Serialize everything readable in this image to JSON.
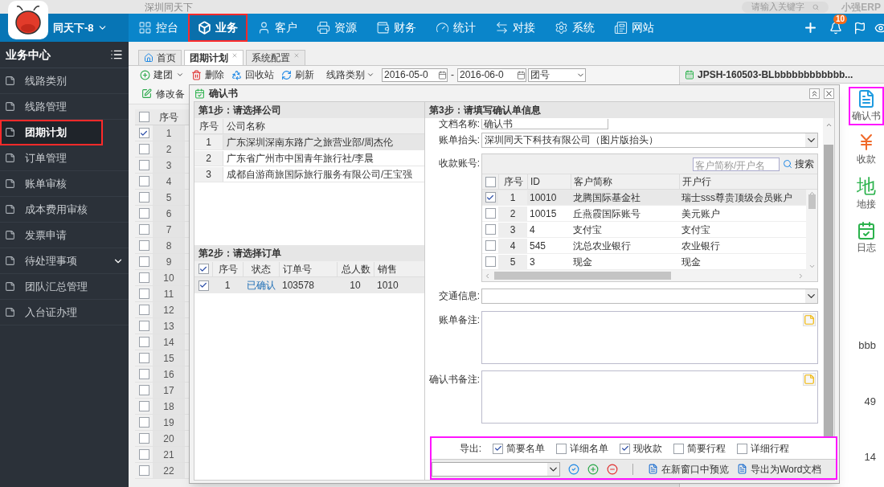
{
  "top_bar": {
    "company": "深圳同天下",
    "search": {
      "placeholder": "请输入关键字"
    },
    "brand": "小强ERP"
  },
  "nav": {
    "account": "同天下-8",
    "notifications": "10",
    "items": [
      {
        "label": "控台",
        "selected": false,
        "highlighted": false
      },
      {
        "label": "业务",
        "selected": true,
        "highlighted": true
      },
      {
        "label": "客户",
        "selected": false,
        "highlighted": false
      },
      {
        "label": "资源",
        "selected": false,
        "highlighted": false
      },
      {
        "label": "财务",
        "selected": false,
        "highlighted": false
      },
      {
        "label": "统计",
        "selected": false,
        "highlighted": false
      },
      {
        "label": "对接",
        "selected": false,
        "highlighted": false
      },
      {
        "label": "系统",
        "selected": false,
        "highlighted": false
      },
      {
        "label": "网站",
        "selected": false,
        "highlighted": false
      }
    ]
  },
  "sidebar": {
    "title": "业务中心",
    "items": [
      {
        "label": "线路类别",
        "selected": false,
        "highlighted": false,
        "expandable": false
      },
      {
        "label": "线路管理",
        "selected": false,
        "highlighted": false,
        "expandable": false
      },
      {
        "label": "团期计划",
        "selected": true,
        "highlighted": true,
        "expandable": false
      },
      {
        "label": "订单管理",
        "selected": false,
        "highlighted": false,
        "expandable": false
      },
      {
        "label": "账单审核",
        "selected": false,
        "highlighted": false,
        "expandable": false
      },
      {
        "label": "成本费用审核",
        "selected": false,
        "highlighted": false,
        "expandable": false
      },
      {
        "label": "发票申请",
        "selected": false,
        "highlighted": false,
        "expandable": false
      },
      {
        "label": "待处理事项",
        "selected": false,
        "highlighted": false,
        "expandable": true
      },
      {
        "label": "团队汇总管理",
        "selected": false,
        "highlighted": false,
        "expandable": false
      },
      {
        "label": "入台证办理",
        "selected": false,
        "highlighted": false,
        "expandable": false
      }
    ]
  },
  "tabs": [
    {
      "label": "首页",
      "selected": false,
      "closable": false
    },
    {
      "label": "团期计划",
      "selected": true,
      "closable": true
    },
    {
      "label": "系统配置",
      "selected": false,
      "closable": true
    }
  ],
  "toolbar": {
    "buttons": [
      {
        "label": "建团",
        "dropdown": true
      },
      {
        "label": "删除",
        "dropdown": false
      },
      {
        "label": "回收站",
        "dropdown": false
      },
      {
        "label": "刷新",
        "dropdown": false
      }
    ],
    "filter": "线路类别",
    "date_from": "2016-05-0",
    "separator": "-",
    "date_to": "2016-06-0",
    "field": "团号",
    "edit_note": "修改备"
  },
  "grid": {
    "column": "序号",
    "all_checked": false,
    "rows": [
      {
        "index": "1",
        "checked": true
      },
      {
        "index": "2",
        "checked": false
      },
      {
        "index": "3",
        "checked": false
      },
      {
        "index": "4",
        "checked": false
      },
      {
        "index": "5",
        "checked": false
      },
      {
        "index": "6",
        "checked": false
      },
      {
        "index": "7",
        "checked": false
      },
      {
        "index": "8",
        "checked": false
      },
      {
        "index": "9",
        "checked": false
      },
      {
        "index": "10",
        "checked": false
      },
      {
        "index": "11",
        "checked": false
      },
      {
        "index": "12",
        "checked": false
      },
      {
        "index": "13",
        "checked": false
      },
      {
        "index": "14",
        "checked": false
      },
      {
        "index": "15",
        "checked": false
      },
      {
        "index": "16",
        "checked": false
      },
      {
        "index": "17",
        "checked": false
      },
      {
        "index": "18",
        "checked": false
      },
      {
        "index": "19",
        "checked": false
      },
      {
        "index": "20",
        "checked": false
      },
      {
        "index": "21",
        "checked": false
      },
      {
        "index": "22",
        "checked": false
      }
    ]
  },
  "detail": {
    "tab": "JPSH-160503-BLbbbbbbbbbbbb...",
    "fragments": [
      "bbb",
      "49",
      "14"
    ],
    "tools": [
      {
        "label": "确认书",
        "kind": "icon",
        "highlighted": true
      },
      {
        "label": "收款",
        "kind": "icon",
        "highlighted": false
      },
      {
        "label": "地接",
        "kind": "glyph",
        "glyph": "地",
        "highlighted": false
      },
      {
        "label": "日志",
        "kind": "icon",
        "highlighted": false
      }
    ]
  },
  "dialog": {
    "title": "确认书",
    "step1": {
      "title": "第1步：请选择公司",
      "columns": [
        "序号",
        "公司名称"
      ],
      "rows": [
        {
          "index": "1",
          "name": "广东深圳深南东路广之旅营业部/周杰伦",
          "selected": true
        },
        {
          "index": "2",
          "name": "广东省广州市中国青年旅行社/李晨",
          "selected": false
        },
        {
          "index": "3",
          "name": "成都自游商旅国际旅行服务有限公司/王宝强",
          "selected": false
        }
      ]
    },
    "step2": {
      "title": "第2步：请选择订单",
      "all_checked": true,
      "columns": [
        "序号",
        "状态",
        "订单号",
        "总人数",
        "销售"
      ],
      "rows": [
        {
          "checked": true,
          "index": "1",
          "status": "已确认",
          "order": "103578",
          "people": "10",
          "sales": "1010"
        }
      ]
    },
    "step3": {
      "title": "第3步：请填写确认单信息",
      "doc_name": {
        "label": "文档名称:",
        "value": "确认书"
      },
      "header": {
        "label": "账单抬头:",
        "value": "深圳同天下科技有限公司（图片版抬头）"
      },
      "accounts": {
        "label": "收款账号:",
        "all_checked": false,
        "search": {
          "placeholder": "客户简称/开户名"
        },
        "search_button": "搜索",
        "columns": [
          "序号",
          "ID",
          "客户简称",
          "开户行"
        ],
        "rows": [
          {
            "checked": true,
            "selected": true,
            "index": "1",
            "id": "10010",
            "name": "龙腾国际基金社",
            "bank": "瑞士sss尊贵顶级会员账户"
          },
          {
            "checked": false,
            "selected": false,
            "index": "2",
            "id": "10015",
            "name": "丘燕霞国际账号",
            "bank": "美元账户"
          },
          {
            "checked": false,
            "selected": false,
            "index": "3",
            "id": "4",
            "name": "支付宝",
            "bank": "支付宝"
          },
          {
            "checked": false,
            "selected": false,
            "index": "4",
            "id": "545",
            "name": "沈总农业银行",
            "bank": "农业银行"
          },
          {
            "checked": false,
            "selected": false,
            "index": "5",
            "id": "3",
            "name": "现金",
            "bank": "现金"
          }
        ]
      },
      "traffic": {
        "label": "交通信息:"
      },
      "bill_note": {
        "label": "账单备注:"
      },
      "confirm_note": {
        "label": "确认书备注:"
      },
      "export": {
        "label": "导出:",
        "highlighted": true,
        "options": [
          {
            "label": "简要名单",
            "checked": true
          },
          {
            "label": "详细名单",
            "checked": false
          },
          {
            "label": "现收款",
            "checked": true
          },
          {
            "label": "简要行程",
            "checked": false
          },
          {
            "label": "详细行程",
            "checked": false
          }
        ]
      }
    },
    "footer": {
      "preview": "在新窗口中预览",
      "export_word": "导出为Word文档"
    }
  }
}
